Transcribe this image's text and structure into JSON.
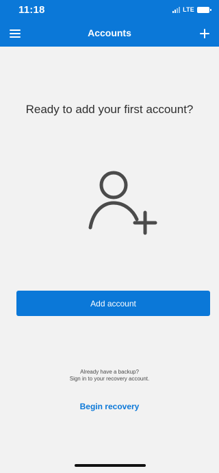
{
  "status_bar": {
    "time": "11:18",
    "network": "LTE"
  },
  "header": {
    "title": "Accounts"
  },
  "main": {
    "headline": "Ready to add your first account?",
    "add_account_label": "Add account",
    "backup_prompt": "Already have a backup?",
    "recovery_hint": "Sign in to your recovery account.",
    "begin_recovery_label": "Begin recovery"
  },
  "icons": {
    "menu": "menu-icon",
    "add": "plus-icon",
    "add_user": "add-user-icon"
  },
  "colors": {
    "brand": "#0b78d8",
    "background": "#f2f2f2",
    "headline_text": "#2f2f2f",
    "icon_stroke": "#4b4b4b"
  }
}
